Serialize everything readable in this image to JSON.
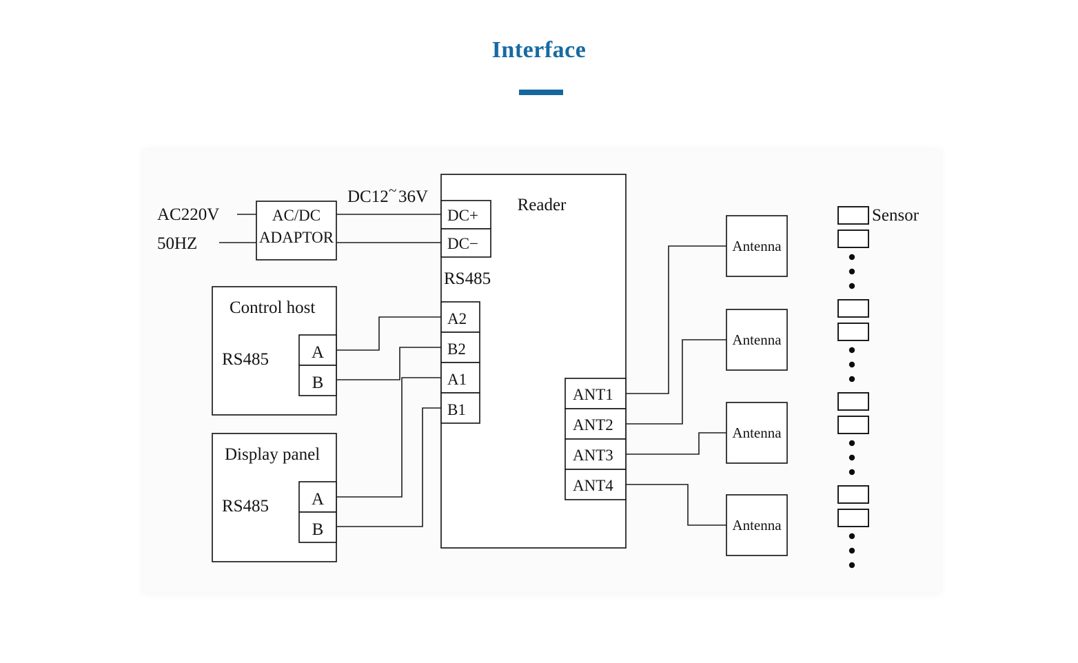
{
  "header": {
    "title": "Interface",
    "accent_color": "#176aa3",
    "underline_color": "#16679e"
  },
  "diagram": {
    "power": {
      "source_line1": "AC220V",
      "source_line2": "50HZ",
      "adaptor_line1": "AC/DC",
      "adaptor_line2": "ADAPTOR",
      "output_voltage_prefix": "DC12",
      "output_voltage_tilde": "~",
      "output_voltage_suffix": "36V"
    },
    "reader": {
      "title": "Reader",
      "power_terminals": [
        {
          "label": "DC+"
        },
        {
          "label": "DC−"
        }
      ],
      "rs485_label": "RS485",
      "rs485_terminals": [
        {
          "label": "A2"
        },
        {
          "label": "B2"
        },
        {
          "label": "A1"
        },
        {
          "label": "B1"
        }
      ],
      "antenna_terminals": [
        {
          "label": "ANT1"
        },
        {
          "label": "ANT2"
        },
        {
          "label": "ANT3"
        },
        {
          "label": "ANT4"
        }
      ]
    },
    "control_host": {
      "title": "Control host",
      "bus_label": "RS485",
      "terminals": [
        {
          "label": "A"
        },
        {
          "label": "B"
        }
      ]
    },
    "display_panel": {
      "title": "Display panel",
      "bus_label": "RS485",
      "terminals": [
        {
          "label": "A"
        },
        {
          "label": "B"
        }
      ]
    },
    "antennas": [
      {
        "label": "Antenna"
      },
      {
        "label": "Antenna"
      },
      {
        "label": "Antenna"
      },
      {
        "label": "Antenna"
      }
    ],
    "sensors": {
      "label": "Sensor",
      "group_count": 4,
      "rects_per_group": 2,
      "dots_per_group": 3
    }
  }
}
